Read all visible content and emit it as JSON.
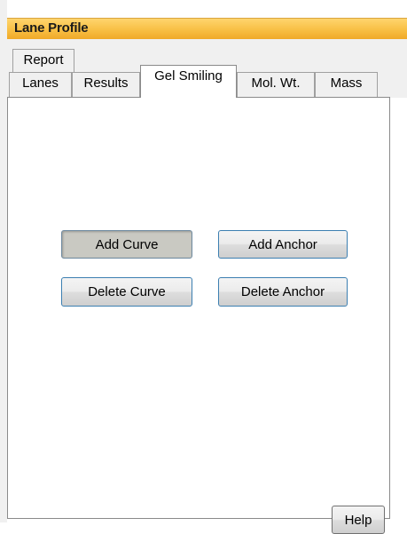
{
  "window": {
    "title": "Lane Profile"
  },
  "tabs": {
    "row1": [
      {
        "label": "Report"
      }
    ],
    "row2": [
      {
        "label": "Lanes"
      },
      {
        "label": "Results"
      },
      {
        "label": "Gel Smiling",
        "selected": true
      },
      {
        "label": "Mol. Wt."
      },
      {
        "label": "Mass"
      }
    ]
  },
  "panel": {
    "buttons": {
      "add_curve": "Add Curve",
      "add_anchor": "Add Anchor",
      "delete_curve": "Delete Curve",
      "delete_anchor": "Delete Anchor",
      "help": "Help"
    }
  },
  "colors": {
    "title_bar": "#f8bf44",
    "button_border": "#3c7fb1",
    "pressed_button": "#c9c9c2"
  }
}
